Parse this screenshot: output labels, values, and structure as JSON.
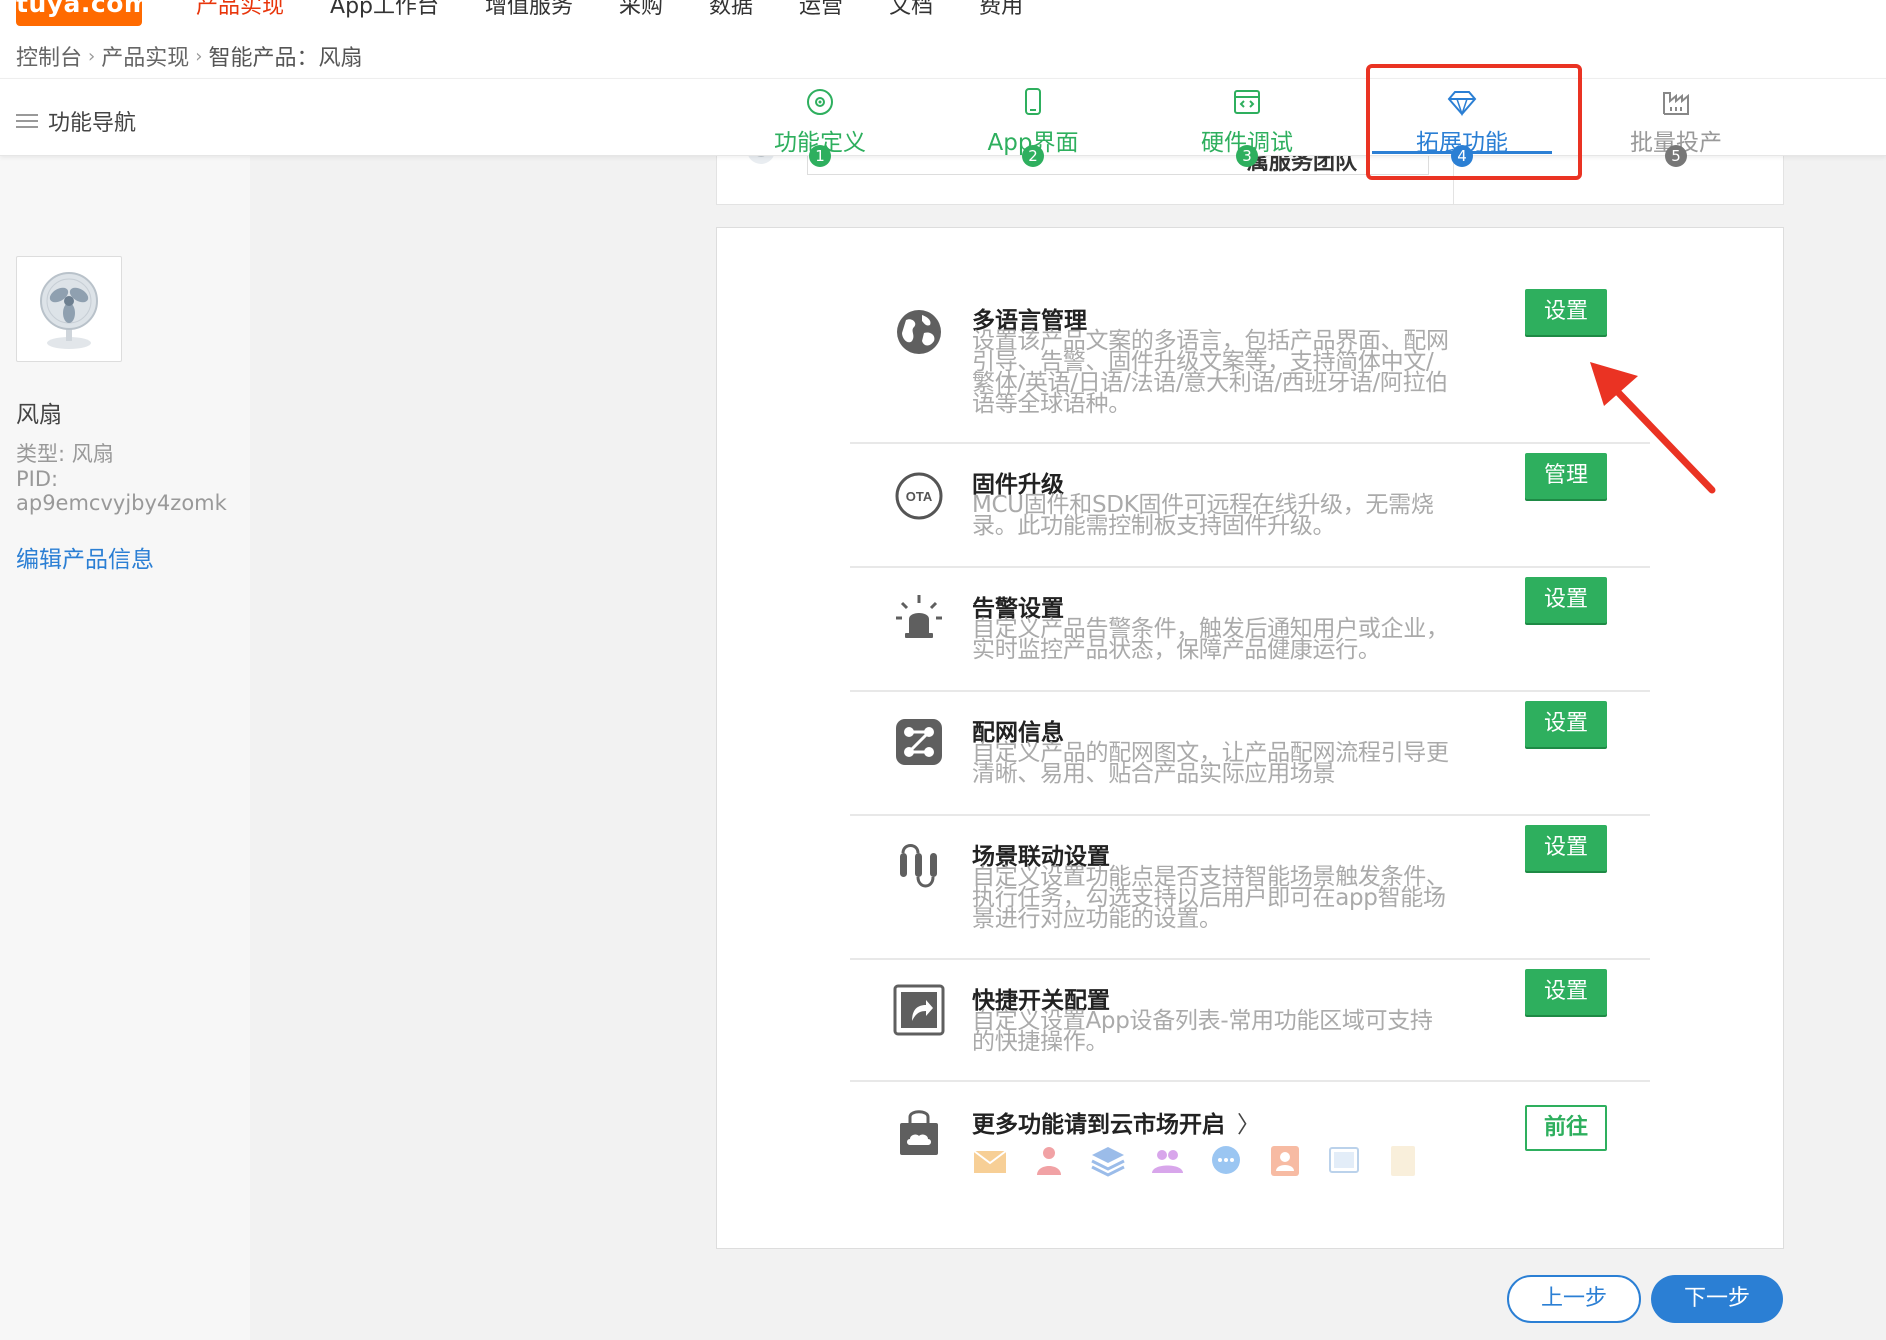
{
  "brand": {
    "logo_text": "tuya.com",
    "accent": "#ff6a00"
  },
  "topnav": {
    "items": [
      {
        "label": "产品实现",
        "active": true
      },
      {
        "label": "App工作台"
      },
      {
        "label": "增值服务"
      },
      {
        "label": "采购"
      },
      {
        "label": "数据"
      },
      {
        "label": "运营"
      },
      {
        "label": "文档"
      },
      {
        "label": "费用"
      }
    ]
  },
  "breadcrumb": [
    "控制台",
    "产品实现",
    "智能产品：风扇"
  ],
  "subheader": {
    "func_nav_label": "功能导航",
    "steps": [
      {
        "label": "功能定义",
        "num": "1",
        "icon": "function-define-icon"
      },
      {
        "label": "App界面",
        "num": "2",
        "icon": "phone-icon"
      },
      {
        "label": "硬件调试",
        "num": "3",
        "icon": "code-window-icon"
      },
      {
        "label": "拓展功能",
        "num": "4",
        "icon": "diamond-icon",
        "active": true
      },
      {
        "label": "批量投产",
        "num": "5",
        "icon": "factory-icon",
        "disabled": true
      }
    ]
  },
  "product": {
    "name": "风扇",
    "type": "类型: 风扇",
    "pid_label": "PID:",
    "pid": "ap9emcvyjby4zomk",
    "edit_link": "编辑产品信息"
  },
  "prev_panel": {
    "partial_text": "属服务团队"
  },
  "features": [
    {
      "title": "多语言管理",
      "desc": "设置该产品文案的多语言，包括产品界面、配网引导、告警、固件升级文案等，支持简体中文/繁体/英语/日语/法语/意大利语/西班牙语/阿拉伯语等全球语种。",
      "button": "设置",
      "icon": "globe-icon"
    },
    {
      "title": "固件升级",
      "desc": "MCU固件和SDK固件可远程在线升级，无需烧录。此功能需控制板支持固件升级。",
      "button": "管理",
      "icon": "ota-icon"
    },
    {
      "title": "告警设置",
      "desc": "自定义产品告警条件，触发后通知用户或企业，实时监控产品状态，保障产品健康运行。",
      "button": "设置",
      "icon": "alarm-light-icon"
    },
    {
      "title": "配网信息",
      "desc": "自定义产品的配网图文，让产品配网流程引导更清晰、易用、贴合产品实际应用场景",
      "button": "设置",
      "icon": "network-config-icon"
    },
    {
      "title": "场景联动设置",
      "desc": "自定义设置功能点是否支持智能场景触发条件、执行任务，勾选支持以后用户即可在app智能场景进行对应功能的设置。",
      "button": "设置",
      "icon": "scene-linkage-icon"
    },
    {
      "title": "快捷开关配置",
      "desc": "自定义设置App设备列表-常用功能区域可支持的快捷操作。",
      "button": "设置",
      "icon": "shortcut-icon"
    }
  ],
  "more": {
    "title": "更多功能请到云市场开启",
    "button": "前往",
    "icon": "cloud-bag-icon",
    "mini_icons": [
      "mail-icon",
      "person-chart-icon",
      "layers-icon",
      "users-icon",
      "chat-icon",
      "contact-icon",
      "screen-icon",
      "document-icon"
    ]
  },
  "footer": {
    "prev": "上一步",
    "next": "下一步"
  },
  "colors": {
    "green": "#2eaf5e",
    "blue": "#2b7fd4",
    "red": "#ea3323",
    "orange": "#ff6a00"
  }
}
